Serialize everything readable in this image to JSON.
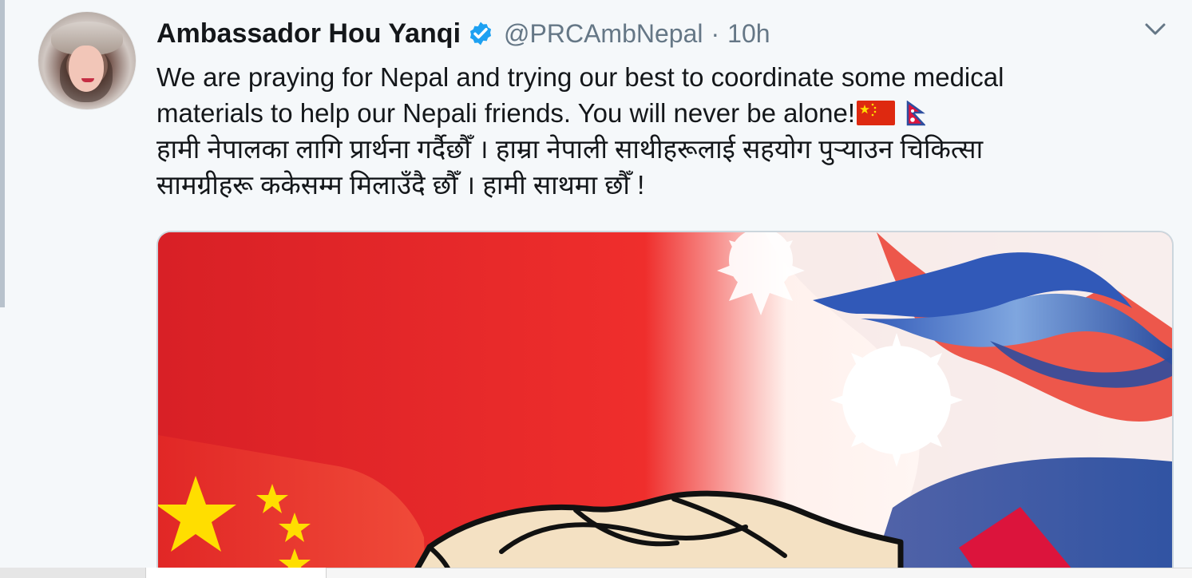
{
  "tweet": {
    "author_name": "Ambassador Hou Yanqi",
    "verified_icon": "verified-badge-icon",
    "handle": "@PRCAmbNepal",
    "separator": "·",
    "time": "10h",
    "menu_icon": "chevron-down-icon",
    "body_lines": [
      "We are praying for Nepal and trying our best to coordinate some medical",
      "materials to help our Nepali friends. You will never be alone!",
      "हामी नेपालका लागि प्रार्थना गर्दैछौँ । हाम्रा नेपाली साथीहरूलाई सहयोग पुऱ्याउन  चिकित्सा",
      "सामग्रीहरू ककेसम्म मिलाउँदै छौँ । हामी साथमा  छौँ !"
    ],
    "emoji": [
      "china-flag-emoji",
      "nepal-flag-emoji"
    ]
  },
  "colors": {
    "background": "#f5f8fa",
    "text": "#14171a",
    "muted": "#657786",
    "verified": "#1da1f2",
    "china_red": "#de2910",
    "china_yellow": "#ffde00",
    "nepal_blue": "#2d4e9f",
    "nepal_red": "#dc143c"
  }
}
